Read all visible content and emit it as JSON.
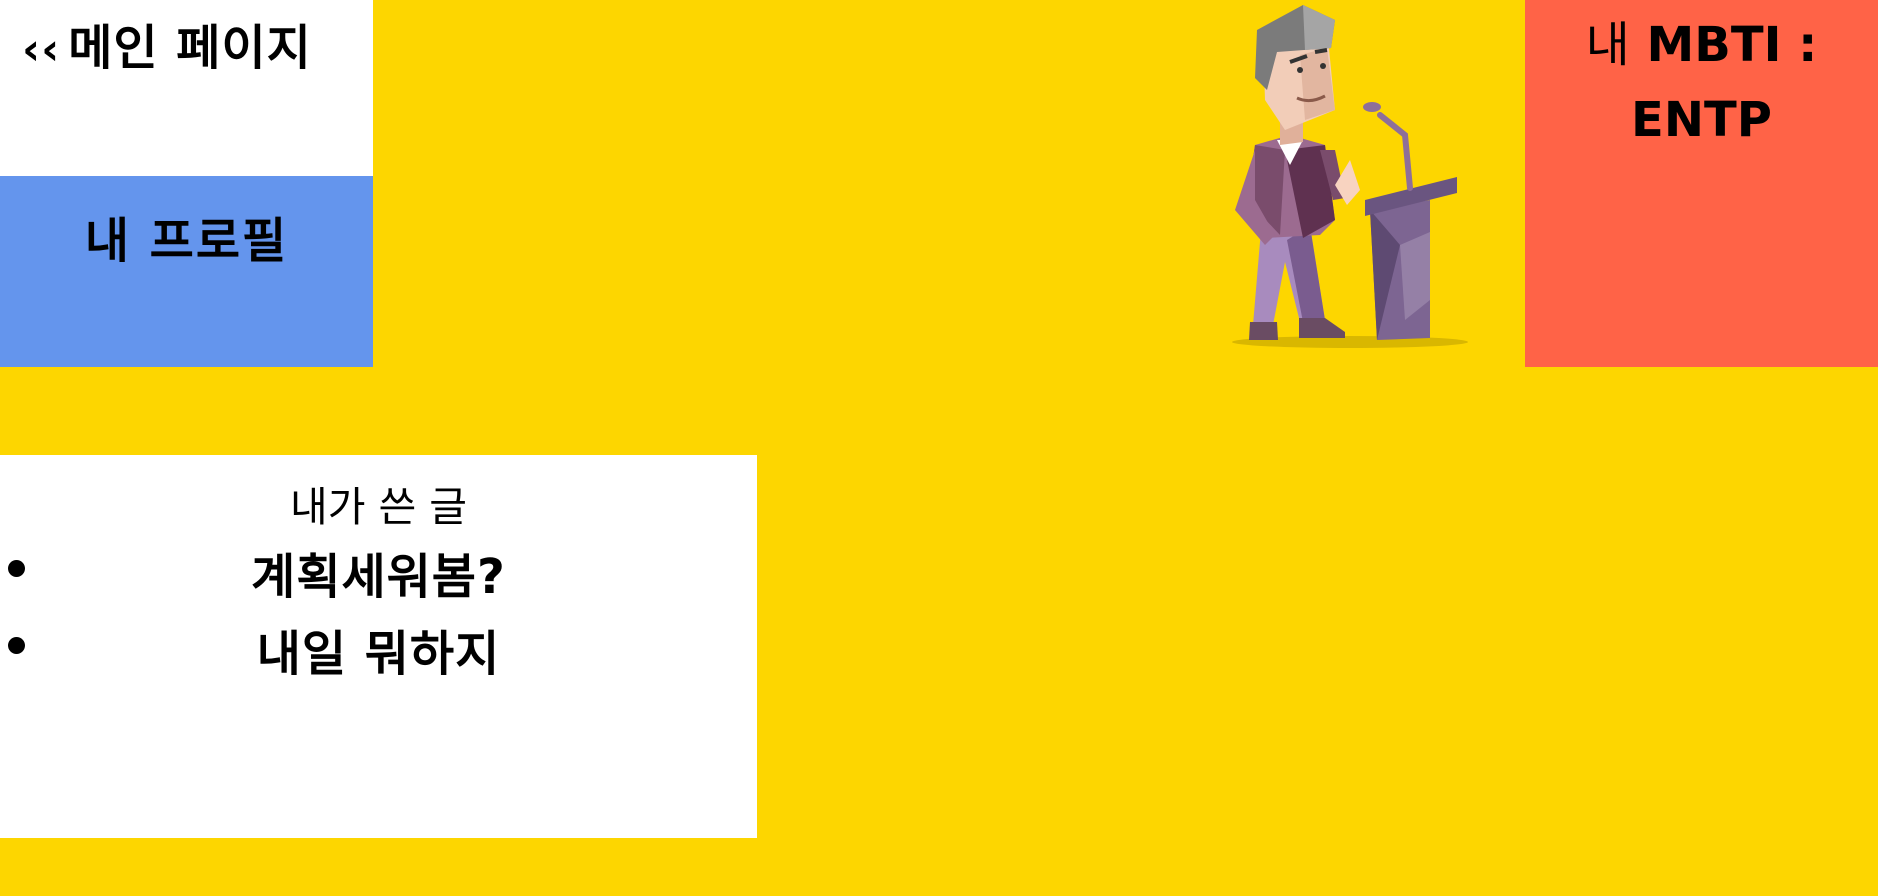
{
  "nav": {
    "back_icon": "double-chevron-left-icon",
    "back_glyph": "‹‹",
    "back_label": "메인 페이지"
  },
  "profile": {
    "title": "내 프로필"
  },
  "mbti": {
    "label": "내",
    "prefix": "MBTI :",
    "value": "ENTP"
  },
  "posts": {
    "heading": "내가 쓴 글",
    "items": [
      {
        "title": "계획세워봄?"
      },
      {
        "title": "내일 뭐하지"
      }
    ]
  },
  "colors": {
    "background": "#FDD600",
    "profile_panel": "#6495ED",
    "mbti_panel": "#FF6347",
    "card": "#FFFFFF"
  }
}
